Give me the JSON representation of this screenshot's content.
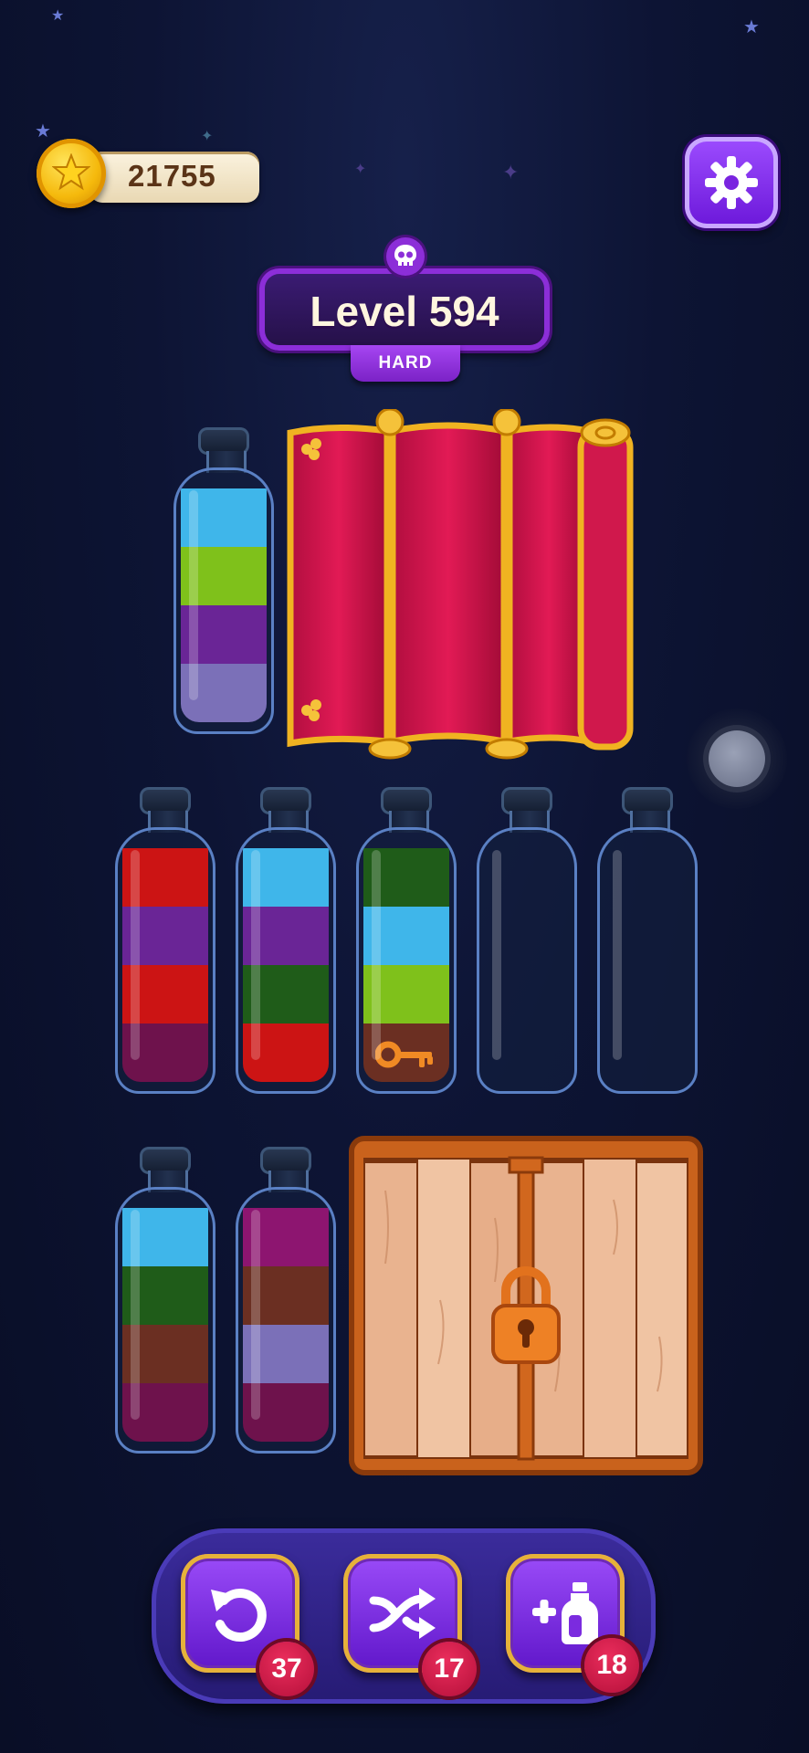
{
  "hud": {
    "coins": "21755",
    "level_title": "Level 594",
    "difficulty": "HARD"
  },
  "colors": {
    "cyan": "#3fb6ea",
    "lime": "#7fc11b",
    "purple": "#6a2596",
    "lavender": "#7b70b8",
    "red": "#cc1414",
    "dark_green": "#1f5c19",
    "maroon": "#6e124c",
    "brown": "#6b2f22",
    "magenta": "#8d1570"
  },
  "bottles": [
    {
      "row": 1,
      "layers_bottom_to_top": [
        "lavender",
        "purple",
        "lime",
        "cyan"
      ]
    },
    {
      "row": 2,
      "layers_bottom_to_top": [
        "maroon",
        "red",
        "purple",
        "red"
      ]
    },
    {
      "row": 2,
      "layers_bottom_to_top": [
        "red",
        "dark_green",
        "purple",
        "cyan"
      ]
    },
    {
      "row": 2,
      "layers_bottom_to_top": [
        "brown",
        "lime",
        "cyan",
        "dark_green"
      ],
      "has_key": true
    },
    {
      "row": 2,
      "layers_bottom_to_top": []
    },
    {
      "row": 2,
      "layers_bottom_to_top": []
    },
    {
      "row": 3,
      "layers_bottom_to_top": [
        "maroon",
        "brown",
        "dark_green",
        "cyan"
      ]
    },
    {
      "row": 3,
      "layers_bottom_to_top": [
        "maroon",
        "lavender",
        "brown",
        "magenta"
      ]
    }
  ],
  "toolbar": {
    "undo_count": "37",
    "shuffle_count": "17",
    "add_bottle_count": "18"
  }
}
